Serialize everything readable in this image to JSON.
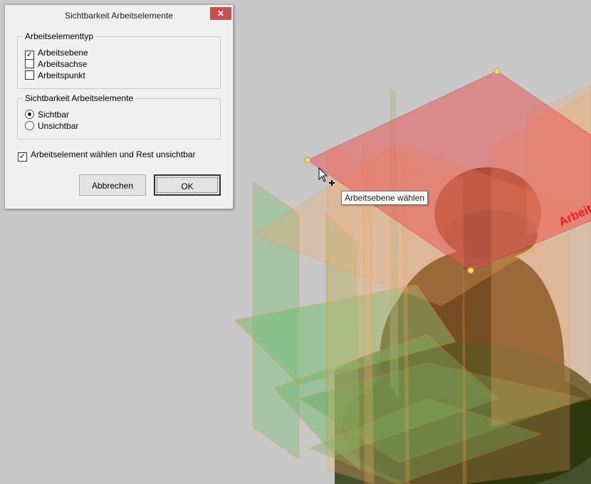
{
  "dialog": {
    "title": "Sichtbarkeit Arbeitselemente",
    "close_symbol": "✕",
    "group1": {
      "legend": "Arbeitselementtyp",
      "options": [
        {
          "label": "Arbeitsebene",
          "checked": true
        },
        {
          "label": "Arbeitsachse",
          "checked": false
        },
        {
          "label": "Arbeitspunkt",
          "checked": false
        }
      ]
    },
    "group2": {
      "legend": "Sichtbarkeit Arbeitselemente",
      "options": [
        {
          "label": "Sichtbar",
          "selected": true
        },
        {
          "label": "Unsichtbar",
          "selected": false
        }
      ]
    },
    "select_rest": {
      "label": "Arbeitselement wählen und Rest unsichtbar",
      "checked": true
    },
    "cancel_label": "Abbrechen",
    "ok_label": "OK",
    "check_mark": "✓"
  },
  "viewport": {
    "plane_label": "Arbeit",
    "tooltip": "Arbeitsebene wählen",
    "colors": {
      "background": "#c8c8c8",
      "plane_edge": "#f08a1c",
      "plane_green": "#6fbf6f",
      "plane_orange": "#f4a868",
      "plane_selected": "#e85a5a",
      "model": "#5a3410"
    }
  }
}
